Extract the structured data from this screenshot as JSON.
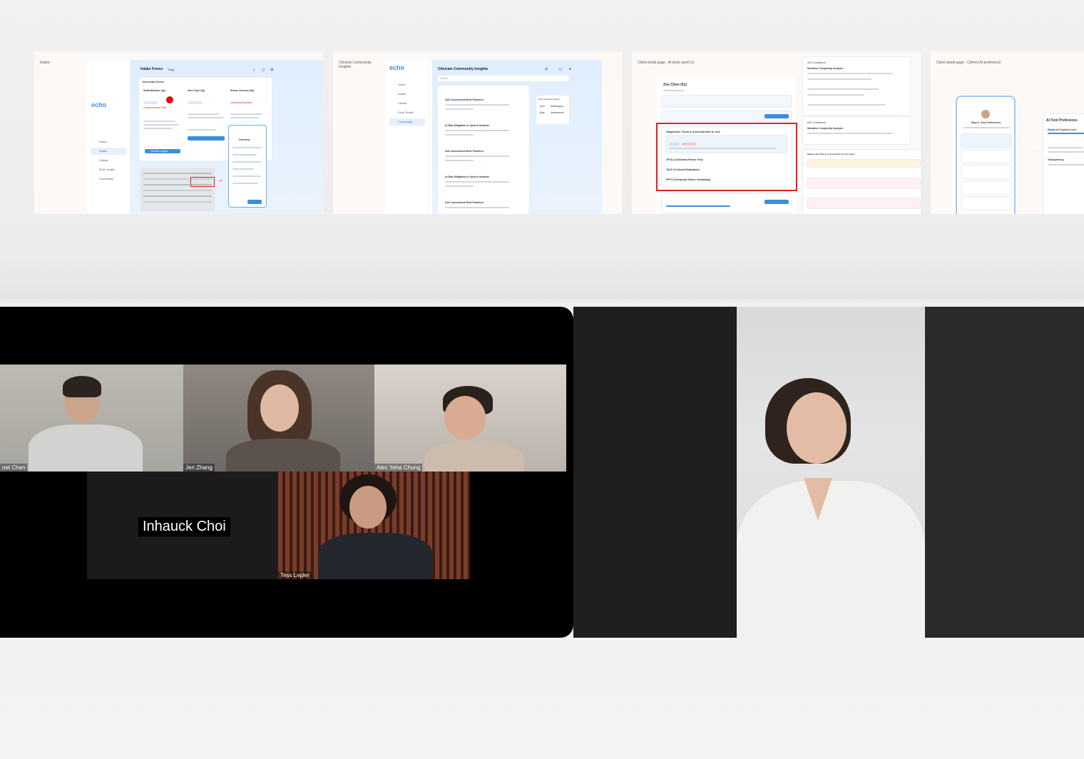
{
  "frames": [
    {
      "label": "Intake",
      "app_title": "Intake Forms",
      "date_chip": "Today",
      "section_heading": "New Intake Forms",
      "logo": "echo",
      "nav": [
        "Home",
        "Intake",
        "Clients",
        "Echo Toolkit",
        "Community"
      ],
      "active_nav": "Intake",
      "clients": [
        {
          "name": "Sofia Martinez (4y)",
          "alert": "Communication Risk"
        },
        {
          "name": "Alex Chen (3y)",
          "alert": ""
        },
        {
          "name": "Emma Johnson (5y)",
          "alert": "Understanding Risk"
        }
      ],
      "submit_label": "Clinical Insights",
      "side_panel_title": "Overview"
    },
    {
      "label": "Clinician Community Insights",
      "logo": "echo",
      "app_title": "Clinician Community Insights",
      "search_placeholder": "Search",
      "nav": [
        "Home",
        "Intake",
        "Clients",
        "Echo Toolkit",
        "Community"
      ],
      "active_nav": "Community",
      "posts": [
        "AAC Assessment Best Practices",
        "AI Bias Mitigation in Speech Analysis",
        "AAC Assessment Best Practices",
        "AI Bias Mitigation in Speech Analysis",
        "AAC Assessment Best Practices"
      ],
      "tags_heading": "Recommended Topics",
      "tags": [
        "AAC",
        "Multilingual",
        "Bias",
        "Assessment"
      ]
    },
    {
      "label": "Client detail page - AI tools used (1)",
      "client_name": "Zoe Chen (5y)",
      "section_highlight": "Diagnostic Tools & Assessments In Use",
      "tools": [
        "GFTA-3 (Goldman-Fristoe Test)",
        "CELF-5 (Clinical Evaluation)",
        "PPVT-5 (Peabody Picture Vocabulary)"
      ],
      "confidence_1": "92% Confidence",
      "analyzer_1": "Narrative Complexity Analyzer",
      "confidence_2": "82% Confidence",
      "analyzer_2": "Narrative Complexity Analyzer",
      "side_heading": "Diagnostic Tools & Assessments for Zoe Chen"
    },
    {
      "label": "Client detail page - Client's AI preference",
      "phone_step": "Step 3: Your Preferences",
      "panel_title": "AI Tool Preference",
      "panel_sub": "Family AI Comfort Level",
      "panel_item": "Transparency"
    }
  ],
  "meeting": {
    "participants": [
      {
        "name": "Janet Chen",
        "display": "net Chen"
      },
      {
        "name": "Jen Zhang",
        "display": "Jen Zhang"
      },
      {
        "name": "Alex Yeha Chung",
        "display": "Alex Yeha Chung"
      },
      {
        "name": "Inhauck Choi",
        "display": "Inhauck Choi"
      },
      {
        "name": "Tess Lepler",
        "display": "Tess Lepler"
      }
    ]
  },
  "colors": {
    "accent": "#3d8de0",
    "alert_red": "#e02020",
    "meeting_bg": "#000000"
  }
}
